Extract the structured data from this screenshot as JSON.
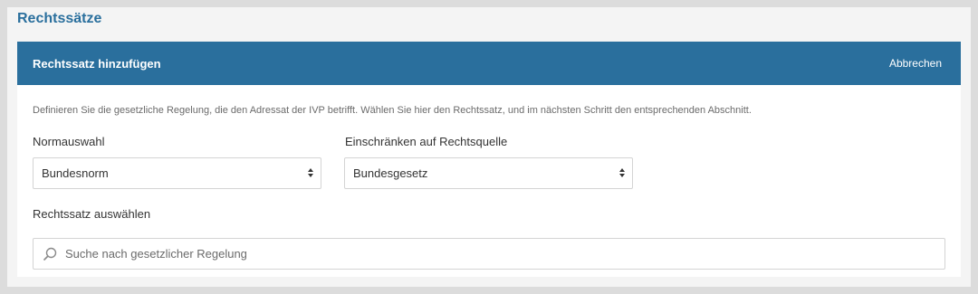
{
  "section": {
    "title": "Rechtssätze"
  },
  "card": {
    "header_title": "Rechtssatz hinzufügen",
    "cancel_label": "Abbrechen",
    "description": "Definieren Sie die gesetzliche Regelung, die den Adressat der IVP betrifft. Wählen Sie hier den Rechtssatz, und im nächsten Schritt den entsprechenden Abschnitt."
  },
  "form": {
    "norm": {
      "label": "Normauswahl",
      "value": "Bundesnorm"
    },
    "source": {
      "label": "Einschränken auf Rechtsquelle",
      "value": "Bundesgesetz"
    },
    "rechtssatz": {
      "label": "Rechtssatz auswählen",
      "placeholder": "Suche nach gesetzlicher Regelung"
    }
  },
  "colors": {
    "header": "#2a6f9d",
    "title": "#2a6f9d"
  }
}
